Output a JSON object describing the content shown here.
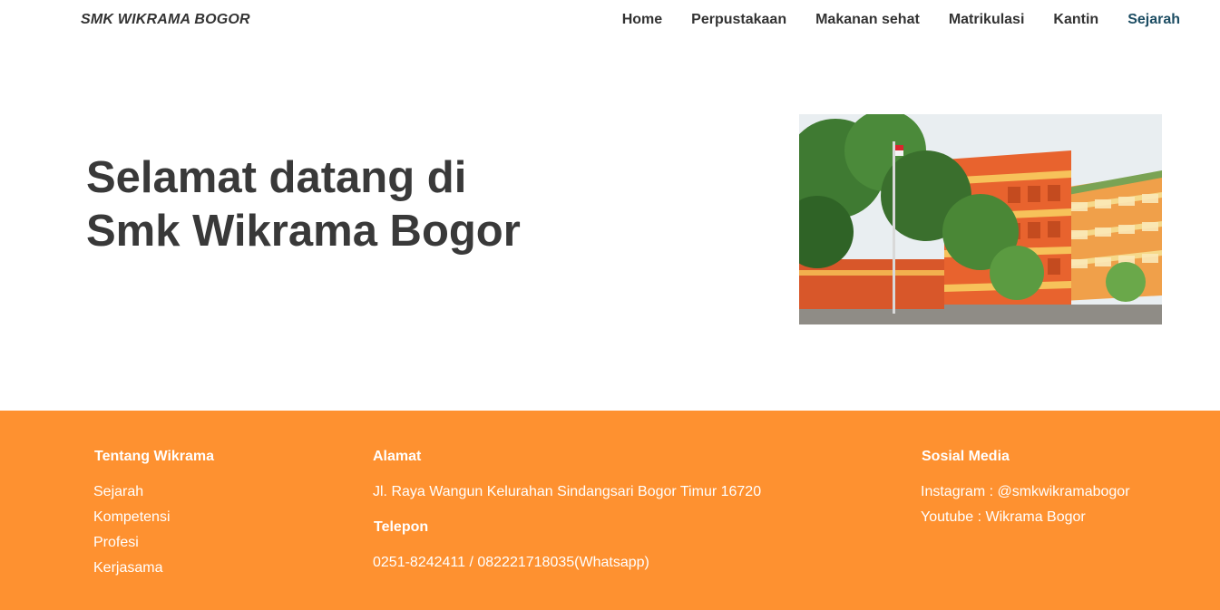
{
  "navbar": {
    "brand": "SMK WIKRAMA BOGOR",
    "links": [
      {
        "label": "Home"
      },
      {
        "label": "Perpustakaan"
      },
      {
        "label": "Makanan sehat"
      },
      {
        "label": "Matrikulasi"
      },
      {
        "label": "Kantin"
      },
      {
        "label": "Sejarah"
      }
    ]
  },
  "hero": {
    "title_line1": "Selamat datang di",
    "title_line2": "Smk Wikrama Bogor"
  },
  "footer": {
    "about": {
      "heading": "Tentang Wikrama",
      "links": [
        "Sejarah",
        "Kompetensi",
        "Profesi",
        "Kerjasama"
      ]
    },
    "address": {
      "heading": "Alamat",
      "text": "Jl. Raya Wangun Kelurahan Sindangsari Bogor Timur 16720",
      "phone_heading": "Telepon",
      "phone": "0251-8242411 / 082221718035(Whatsapp)"
    },
    "social": {
      "heading": "Sosial Media",
      "instagram": "Instagram : @smkwikramabogor",
      "youtube": "Youtube : Wikrama Bogor"
    }
  },
  "colors": {
    "footer_bg": "#fe9130",
    "active_link": "#1d4d63",
    "text": "#333333"
  }
}
